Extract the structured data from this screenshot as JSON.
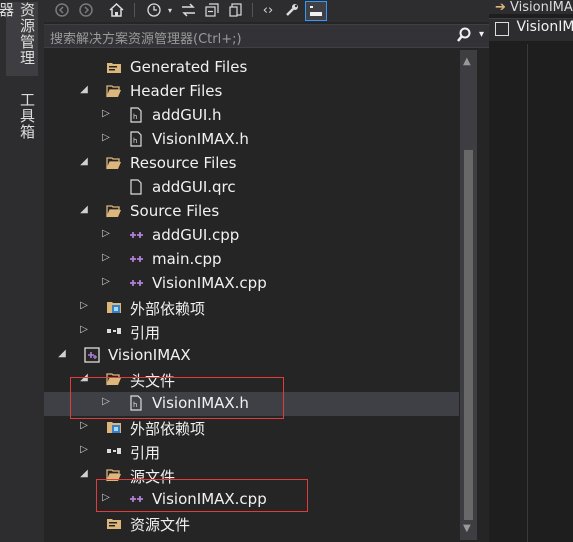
{
  "left_tabs": {
    "solution_explorer": "资源管理器",
    "toolbox": "工具箱"
  },
  "toolbar": {
    "back_icon": "circle-arrow-left",
    "forward_icon": "circle-arrow-right",
    "home_icon": "home",
    "history_icon": "clock",
    "sync_icon": "sync-arrows",
    "collapse_icon": "collapse-all",
    "show_all_icon": "show-all-files",
    "code_icon": "code-brackets",
    "properties_icon": "wrench",
    "preview_icon": "preview-pane"
  },
  "search": {
    "placeholder": "搜索解决方案资源管理器(Ctrl+;)"
  },
  "tree": [
    {
      "label": "Generated Files",
      "icon": "filter-folder",
      "expander": ""
    },
    {
      "label": "Header Files",
      "icon": "filter-folder-open",
      "expander": "expanded"
    },
    {
      "label": "addGUI.h",
      "icon": "header-file",
      "expander": "collapsed"
    },
    {
      "label": "VisionIMAX.h",
      "icon": "header-file",
      "expander": "collapsed"
    },
    {
      "label": "Resource Files",
      "icon": "filter-folder-open",
      "expander": "expanded"
    },
    {
      "label": "addGUI.qrc",
      "icon": "file",
      "expander": ""
    },
    {
      "label": "Source Files",
      "icon": "filter-folder-open",
      "expander": "expanded"
    },
    {
      "label": "addGUI.cpp",
      "icon": "cpp-file",
      "expander": "collapsed"
    },
    {
      "label": "main.cpp",
      "icon": "cpp-file",
      "expander": "collapsed"
    },
    {
      "label": "VisionIMAX.cpp",
      "icon": "cpp-file",
      "expander": "collapsed"
    },
    {
      "label": "外部依赖项",
      "icon": "external-deps",
      "expander": "collapsed"
    },
    {
      "label": "引用",
      "icon": "references",
      "expander": "collapsed"
    },
    {
      "label": "VisionIMAX",
      "icon": "project",
      "expander": "expanded"
    },
    {
      "label": "头文件",
      "icon": "filter-folder-open",
      "expander": "expanded"
    },
    {
      "label": "VisionIMAX.h",
      "icon": "header-file",
      "expander": "collapsed"
    },
    {
      "label": "外部依赖项",
      "icon": "external-deps",
      "expander": "collapsed"
    },
    {
      "label": "引用",
      "icon": "references",
      "expander": "collapsed"
    },
    {
      "label": "源文件",
      "icon": "filter-folder-open",
      "expander": "expanded"
    },
    {
      "label": "VisionIMAX.cpp",
      "icon": "cpp-file",
      "expander": "collapsed"
    },
    {
      "label": "资源文件",
      "icon": "filter-folder",
      "expander": ""
    }
  ],
  "editor": {
    "tab_top": "VisionIMAX",
    "tab_active": "VisionIMAX"
  },
  "colors": {
    "highlight_box": "#e03c3c",
    "panel_bg": "#252526",
    "accent": "#3399ff"
  }
}
